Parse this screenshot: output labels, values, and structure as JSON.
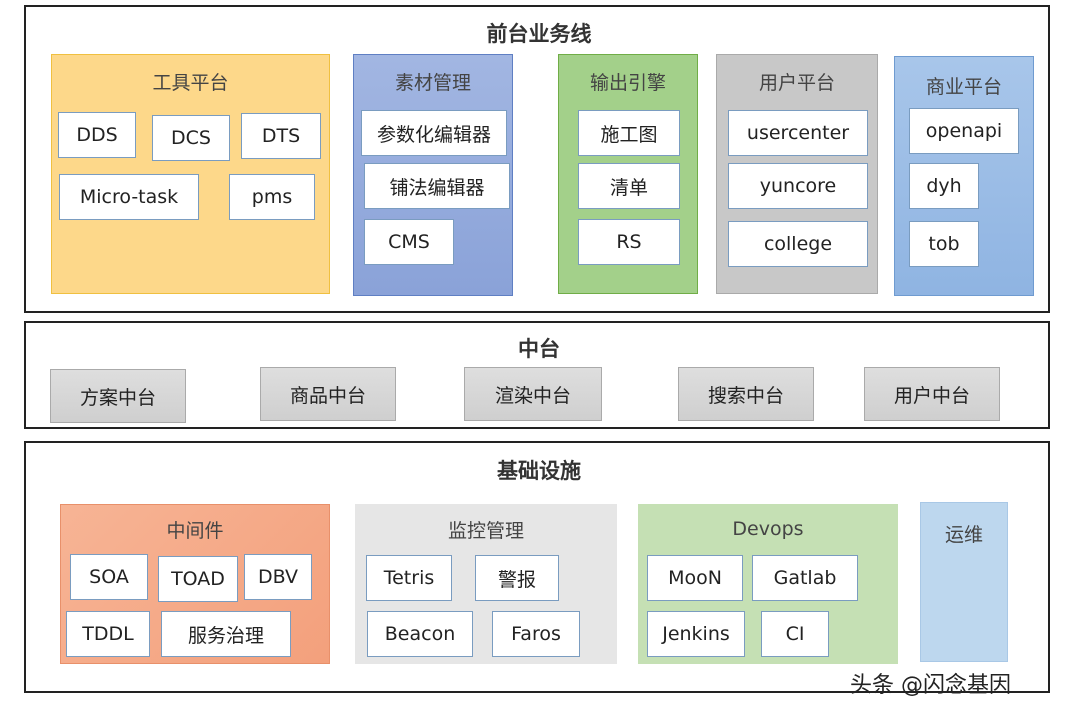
{
  "front": {
    "title": "前台业务线",
    "groups": [
      {
        "title": "工具平台",
        "items": [
          "DDS",
          "DCS",
          "DTS",
          "Micro-task",
          "pms"
        ]
      },
      {
        "title": "素材管理",
        "items": [
          "参数化编辑器",
          "铺法编辑器",
          "CMS"
        ]
      },
      {
        "title": "输出引擎",
        "items": [
          "施工图",
          "清单",
          "RS"
        ]
      },
      {
        "title": "用户平台",
        "items": [
          "usercenter",
          "yuncore",
          "college"
        ]
      },
      {
        "title": "商业平台",
        "items": [
          "openapi",
          "dyh",
          "tob"
        ]
      }
    ]
  },
  "middle": {
    "title": "中台",
    "items": [
      "方案中台",
      "商品中台",
      "渲染中台",
      "搜索中台",
      "用户中台"
    ]
  },
  "infra": {
    "title": "基础设施",
    "groups": [
      {
        "title": "中间件",
        "items": [
          "SOA",
          "TOAD",
          "DBV",
          "TDDL",
          "服务治理"
        ]
      },
      {
        "title": "监控管理",
        "items": [
          "Tetris",
          "警报",
          "Beacon",
          "Faros"
        ]
      },
      {
        "title": "Devops",
        "items": [
          "MooN",
          "Gatlab",
          "Jenkins",
          "CI"
        ]
      },
      {
        "title": "运维",
        "items": []
      }
    ]
  },
  "watermark": "头条 @闪念基因",
  "colors": {
    "tools": "#fdd88a",
    "material": "#8fa7db",
    "output": "#a3d08a",
    "user": "#c8c8c8",
    "business": "#9dc0e8",
    "middleware": "#f4a683",
    "monitor": "#e6e6e6",
    "devops": "#c5e0b4",
    "ops": "#bdd7ee"
  }
}
